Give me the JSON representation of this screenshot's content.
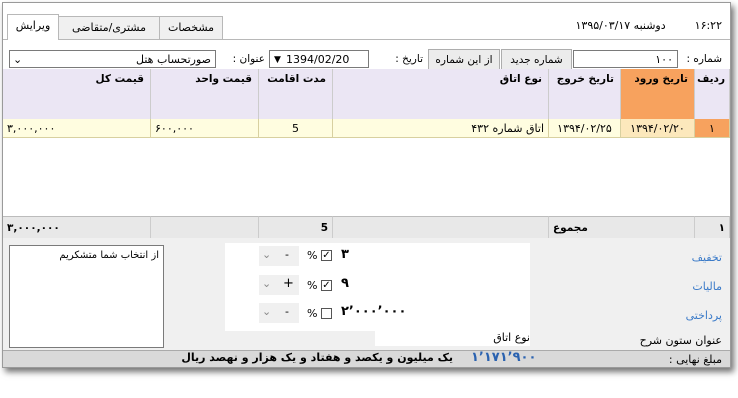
{
  "tabs": {
    "edit": "ویرایش",
    "customer": "مشتری/متقاضی",
    "details": "مشخصات"
  },
  "header": {
    "time": "۱۶:۲۲",
    "date": "دوشنبه ۱۳۹۵/۰۳/۱۷"
  },
  "toolbar": {
    "number_label": "شماره :",
    "number_value": "۱۰۰",
    "new_number_label": "شماره جدید",
    "from_number_label": "از این شماره",
    "date_label": "تاریخ :",
    "date_value": "1394/02/20",
    "title_label": "عنوان :",
    "title_value": "صورتحساب هتل"
  },
  "table": {
    "columns": [
      "ردیف",
      "تاریخ ورود",
      "تاریخ خروج",
      "نوع اتاق",
      "مدت اقامت",
      "قیمت واحد",
      "قیمت کل"
    ],
    "rows": [
      {
        "row": "۱",
        "checkin": "۱۳۹۴/۰۲/۲۰",
        "checkout": "۱۳۹۴/۰۲/۲۵",
        "room": "اتاق شماره ۴۳۲",
        "stay": "5",
        "unit": "۶۰۰,۰۰۰",
        "total": "۳,۰۰۰,۰۰۰"
      }
    ],
    "footer": {
      "row": "۱",
      "sum_label": "مجموع",
      "stay": "5",
      "total": "۳,۰۰۰,۰۰۰"
    }
  },
  "adjustments": {
    "discount": {
      "label": "تخفیف",
      "value": "۳",
      "percent_symbol": "%",
      "sign": "-"
    },
    "tax": {
      "label": "مالیات",
      "value": "۹",
      "percent_symbol": "%",
      "sign": "+"
    },
    "payable": {
      "label": "پرداختی",
      "value": "۲٬۰۰۰٬۰۰۰",
      "percent_symbol": "%",
      "sign": "-"
    },
    "column_title_label": "عنوان ستون شرح",
    "column_title_value": "نوع اتاق"
  },
  "notes": {
    "text": "از انتخاب شما متشکریم"
  },
  "final": {
    "label": "مبلغ نهایی :",
    "amount": "۱٬۱۷۱٬۹۰۰",
    "words": "یک میلیون و یکصد و هفتاد و یک هزار و نهصد ریال"
  },
  "colors": {
    "accent": "#f7a25e",
    "header_bg": "#ebe6f4",
    "row_bg": "#fffde0",
    "link": "#3a7ac8"
  }
}
